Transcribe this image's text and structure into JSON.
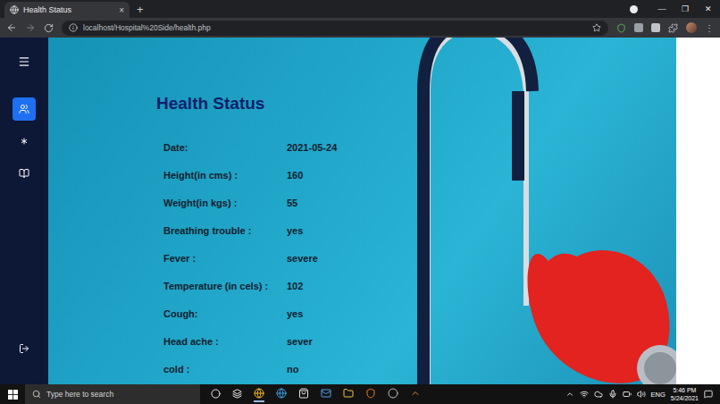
{
  "browser": {
    "tabs": [
      {
        "title": "Health Status",
        "selected": true,
        "close": "×"
      }
    ],
    "new_tab": "+",
    "address": "localhost/Hospital%20Side/health.php",
    "window_controls": [
      "—",
      "❐",
      "✕"
    ]
  },
  "sidebar": {
    "items": [
      {
        "selected": true
      },
      {
        "selected": false
      },
      {
        "selected": false
      }
    ]
  },
  "page": {
    "title": "Health Status",
    "fields": [
      {
        "label": "Date:",
        "value": "2021-05-24"
      },
      {
        "label": "Height(in cms) :",
        "value": "160"
      },
      {
        "label": "Weight(in kgs) :",
        "value": "55"
      },
      {
        "label": "Breathing trouble :",
        "value": "yes"
      },
      {
        "label": "Fever :",
        "value": "severe"
      },
      {
        "label": "Temperature (in cels) :",
        "value": "102"
      },
      {
        "label": "Cough:",
        "value": "yes"
      },
      {
        "label": "Head ache :",
        "value": "sever"
      },
      {
        "label": "cold :",
        "value": "no"
      }
    ]
  },
  "taskbar": {
    "search_placeholder": "Type here to search",
    "language": "ENG",
    "time": "5:46 PM",
    "date": "5/24/2021"
  }
}
